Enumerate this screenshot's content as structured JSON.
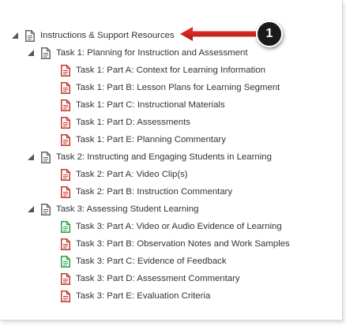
{
  "colors": {
    "text": "#333333",
    "doc_gray": "#666666",
    "doc_red": "#c0392b",
    "doc_green": "#27a244",
    "arrow": "#d9211c",
    "badge": "#1a1a1a"
  },
  "tree": {
    "root": {
      "label": "Instructions & Support Resources",
      "icon": "gray-document-icon",
      "expanded": true
    },
    "task1": {
      "label": "Task 1: Planning for Instruction and Assessment",
      "icon": "gray-document-icon",
      "items": [
        {
          "label": "Task 1: Part A: Context for Learning Information",
          "icon": "red-document-icon"
        },
        {
          "label": "Task 1: Part B: Lesson Plans for Learning Segment",
          "icon": "red-document-icon"
        },
        {
          "label": "Task 1: Part C: Instructional Materials",
          "icon": "red-document-icon"
        },
        {
          "label": "Task 1: Part D: Assessments",
          "icon": "red-document-icon"
        },
        {
          "label": "Task 1: Part E: Planning Commentary",
          "icon": "red-document-icon"
        }
      ]
    },
    "task2": {
      "label": "Task 2: Instructing and Engaging Students in Learning",
      "icon": "gray-document-icon",
      "items": [
        {
          "label": "Task 2: Part A: Video Clip(s)",
          "icon": "red-document-icon"
        },
        {
          "label": "Task 2: Part B: Instruction Commentary",
          "icon": "red-document-icon"
        }
      ]
    },
    "task3": {
      "label": "Task 3: Assessing Student Learning",
      "icon": "gray-document-icon",
      "items": [
        {
          "label": "Task 3: Part A: Video or Audio Evidence of Learning",
          "icon": "green-document-icon"
        },
        {
          "label": "Task 3: Part B: Observation Notes and Work Samples",
          "icon": "red-document-icon"
        },
        {
          "label": "Task 3: Part C: Evidence of Feedback",
          "icon": "green-document-icon"
        },
        {
          "label": "Task 3: Part D: Assessment Commentary",
          "icon": "red-document-icon"
        },
        {
          "label": "Task 3: Part E: Evaluation Criteria",
          "icon": "red-document-icon"
        }
      ]
    }
  },
  "callout": {
    "badge_number": "1",
    "arrow_icon": "red-arrow-left-icon"
  }
}
